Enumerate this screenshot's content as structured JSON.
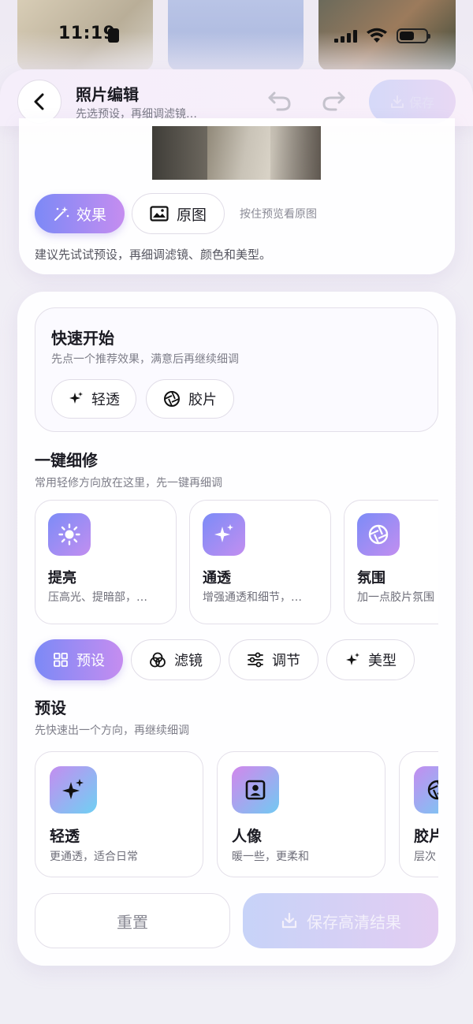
{
  "status_bar": {
    "time": "11:19"
  },
  "header": {
    "title": "照片编辑",
    "subtitle": "先选预设，再细调滤镜…",
    "save_label": "保存"
  },
  "preview": {
    "effect_label": "效果",
    "original_label": "原图",
    "hold_hint": "按住预览看原图",
    "tip": "建议先试试预设，再细调滤镜、颜色和美型。"
  },
  "quick_start": {
    "title": "快速开始",
    "subtitle": "先点一个推荐效果，满意后再继续细调",
    "chips": [
      {
        "label": "轻透",
        "icon": "sparkle-icon"
      },
      {
        "label": "胶片",
        "icon": "aperture-icon"
      }
    ]
  },
  "one_tap": {
    "title": "一键细修",
    "subtitle": "常用轻修方向放在这里，先一键再细调",
    "items": [
      {
        "title": "提亮",
        "desc": "压高光、提暗部，…",
        "icon": "sun-icon"
      },
      {
        "title": "通透",
        "desc": "增强通透和细节，…",
        "icon": "sparkle-icon"
      },
      {
        "title": "氛围",
        "desc": "加一点胶片氛围",
        "icon": "aperture-icon"
      }
    ]
  },
  "tabs": [
    {
      "label": "预设",
      "icon": "grid-icon",
      "active": true
    },
    {
      "label": "滤镜",
      "icon": "filter-icon",
      "active": false
    },
    {
      "label": "调节",
      "icon": "sliders-icon",
      "active": false
    },
    {
      "label": "美型",
      "icon": "sparkle-icon",
      "active": false
    }
  ],
  "presets": {
    "title": "预设",
    "subtitle": "先快速出一个方向，再继续细调",
    "items": [
      {
        "title": "轻透",
        "desc": "更通透，适合日常",
        "icon": "sparkle-icon"
      },
      {
        "title": "人像",
        "desc": "暖一些，更柔和",
        "icon": "portrait-icon"
      },
      {
        "title": "胶片",
        "desc": "层次",
        "icon": "aperture-icon"
      }
    ]
  },
  "footer": {
    "reset_label": "重置",
    "save_hd_label": "保存高清结果"
  },
  "colors": {
    "accent_start": "#7c89f6",
    "accent_end": "#c58df0"
  }
}
